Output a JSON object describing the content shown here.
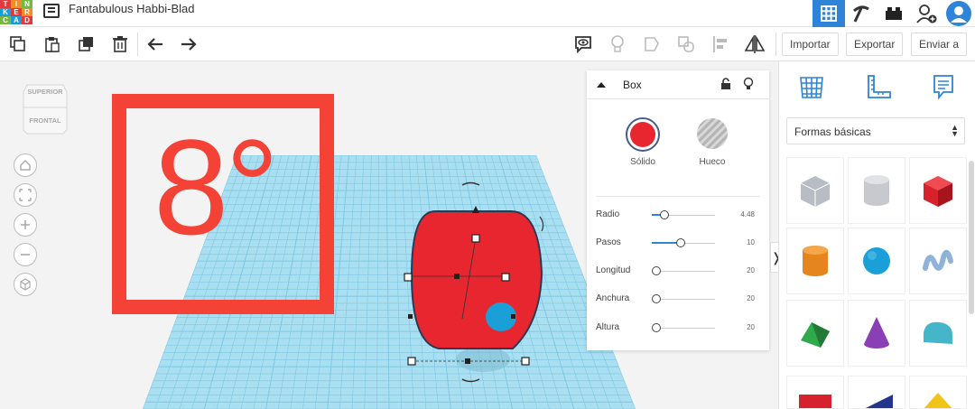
{
  "app": {
    "logo_letters": [
      "T",
      "I",
      "N",
      "K",
      "E",
      "R",
      "C",
      "A",
      "D"
    ],
    "doc_title": "Fantabulous Habbi-Blad"
  },
  "toolbar": {
    "import_label": "Importar",
    "export_label": "Exportar",
    "send_label": "Enviar a"
  },
  "viewcube": {
    "top_label": "SUPERIOR",
    "front_label": "FRONTAL"
  },
  "annotation": {
    "text": "8°"
  },
  "inspector": {
    "shape_name": "Box",
    "solid_label": "Sólido",
    "hole_label": "Hueco",
    "solid_color": "#e8262f",
    "properties": [
      {
        "label": "Radio",
        "value": "4.48",
        "fraction": 0.2
      },
      {
        "label": "Pasos",
        "value": "10",
        "fraction": 0.45
      },
      {
        "label": "Longitud",
        "value": "20",
        "fraction": 0.0
      },
      {
        "label": "Anchura",
        "value": "20",
        "fraction": 0.0
      },
      {
        "label": "Altura",
        "value": "20",
        "fraction": 0.0
      }
    ]
  },
  "shapes_panel": {
    "category": "Formas básicas",
    "shapes": [
      {
        "name": "box-hole-shape",
        "color": "#b8bcc4"
      },
      {
        "name": "cylinder-hole-shape",
        "color": "#c7c9ce"
      },
      {
        "name": "box-shape",
        "color": "#d6222d"
      },
      {
        "name": "cylinder-shape",
        "color": "#e4851e"
      },
      {
        "name": "sphere-shape",
        "color": "#1b9fd8"
      },
      {
        "name": "scribble-shape",
        "color": "#8fb3d6"
      },
      {
        "name": "roof-shape",
        "color": "#2fa94a"
      },
      {
        "name": "cone-shape",
        "color": "#8a3fb4"
      },
      {
        "name": "round-roof-shape",
        "color": "#45b5c9"
      },
      {
        "name": "text-shape",
        "color": "#d6222d"
      },
      {
        "name": "wedge-shape",
        "color": "#24358e"
      },
      {
        "name": "pyramid-shape",
        "color": "#f1c419"
      }
    ]
  },
  "colors": {
    "accent": "#2d84d8",
    "grid": "#a9dff1",
    "annotation": "#f44336"
  }
}
